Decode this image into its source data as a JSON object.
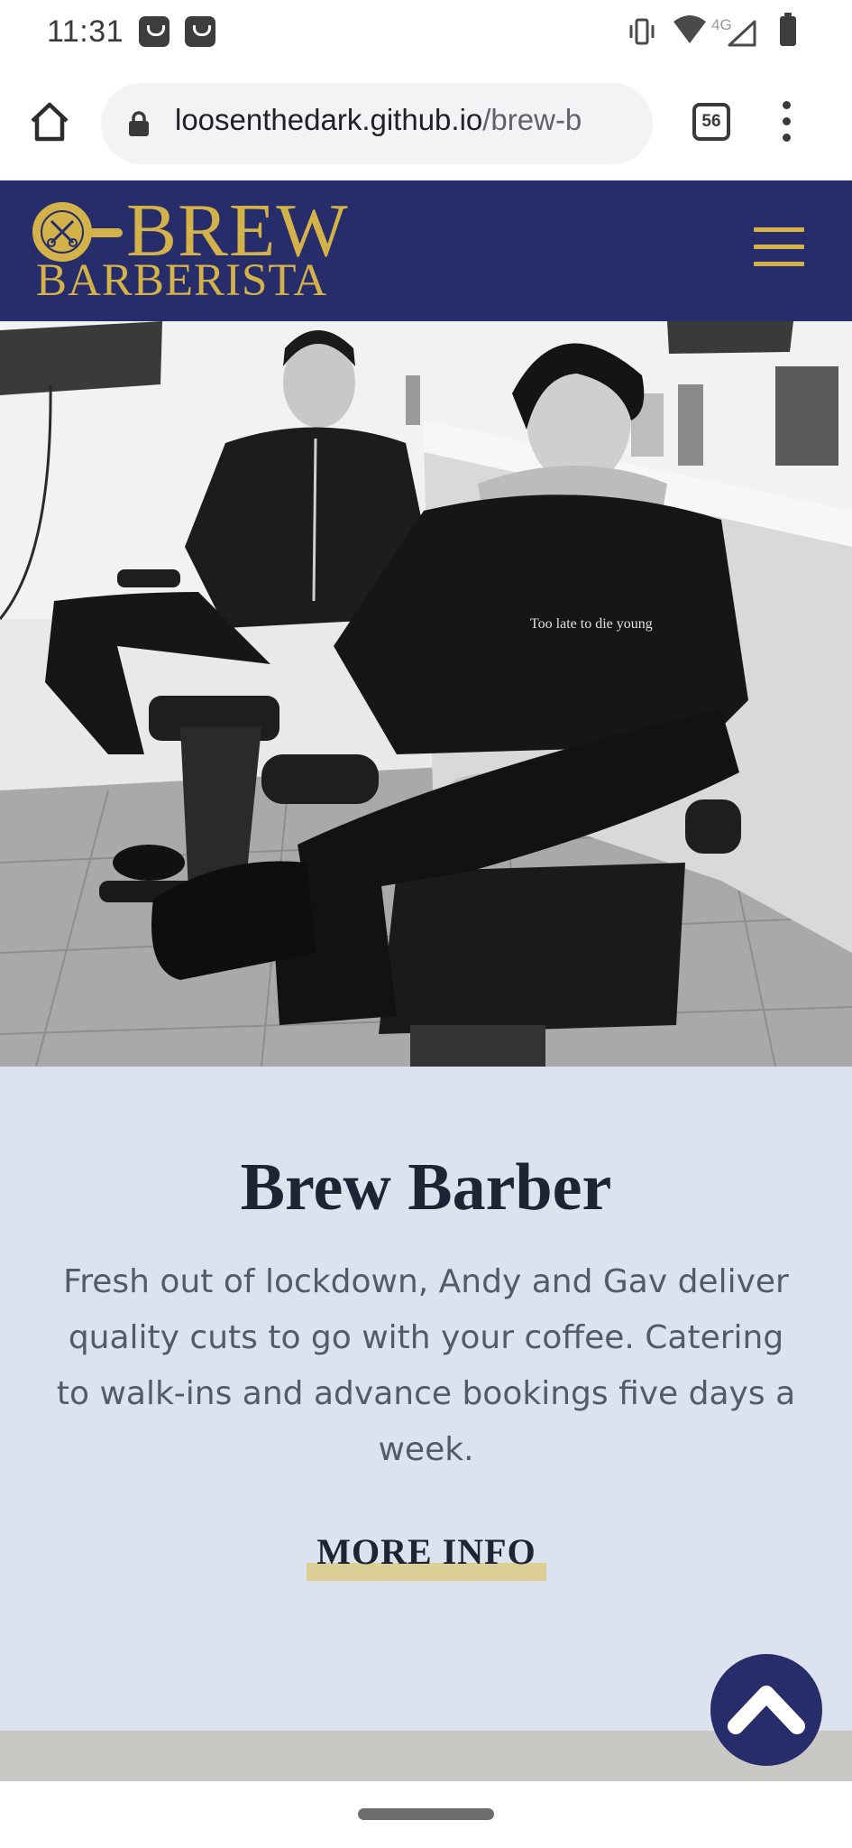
{
  "status_bar": {
    "time": "11:31",
    "network": "4G"
  },
  "browser": {
    "url_host": "loosenthedark.github.io",
    "url_path": "/brew-b",
    "tab_count": "56"
  },
  "header": {
    "logo_line1": "BREW",
    "logo_line2": "BARBERISTA",
    "brand_color": "#272c6a",
    "accent_color": "#d4b24a"
  },
  "hero": {
    "shirt_text": "Too late to die young"
  },
  "section": {
    "title": "Brew Barber",
    "description": "Fresh out of lockdown, Andy and Gav deliver quality cuts to go with your coffee. Catering to walk-ins and advance bookings five days a week.",
    "cta_label": "MORE INFO",
    "background_color": "#dce2ee"
  },
  "icons": {
    "home": "home-icon",
    "lock": "lock-icon",
    "menu": "more-vert-icon",
    "hamburger": "hamburger-menu-icon",
    "scroll_top": "chevron-up-icon"
  }
}
